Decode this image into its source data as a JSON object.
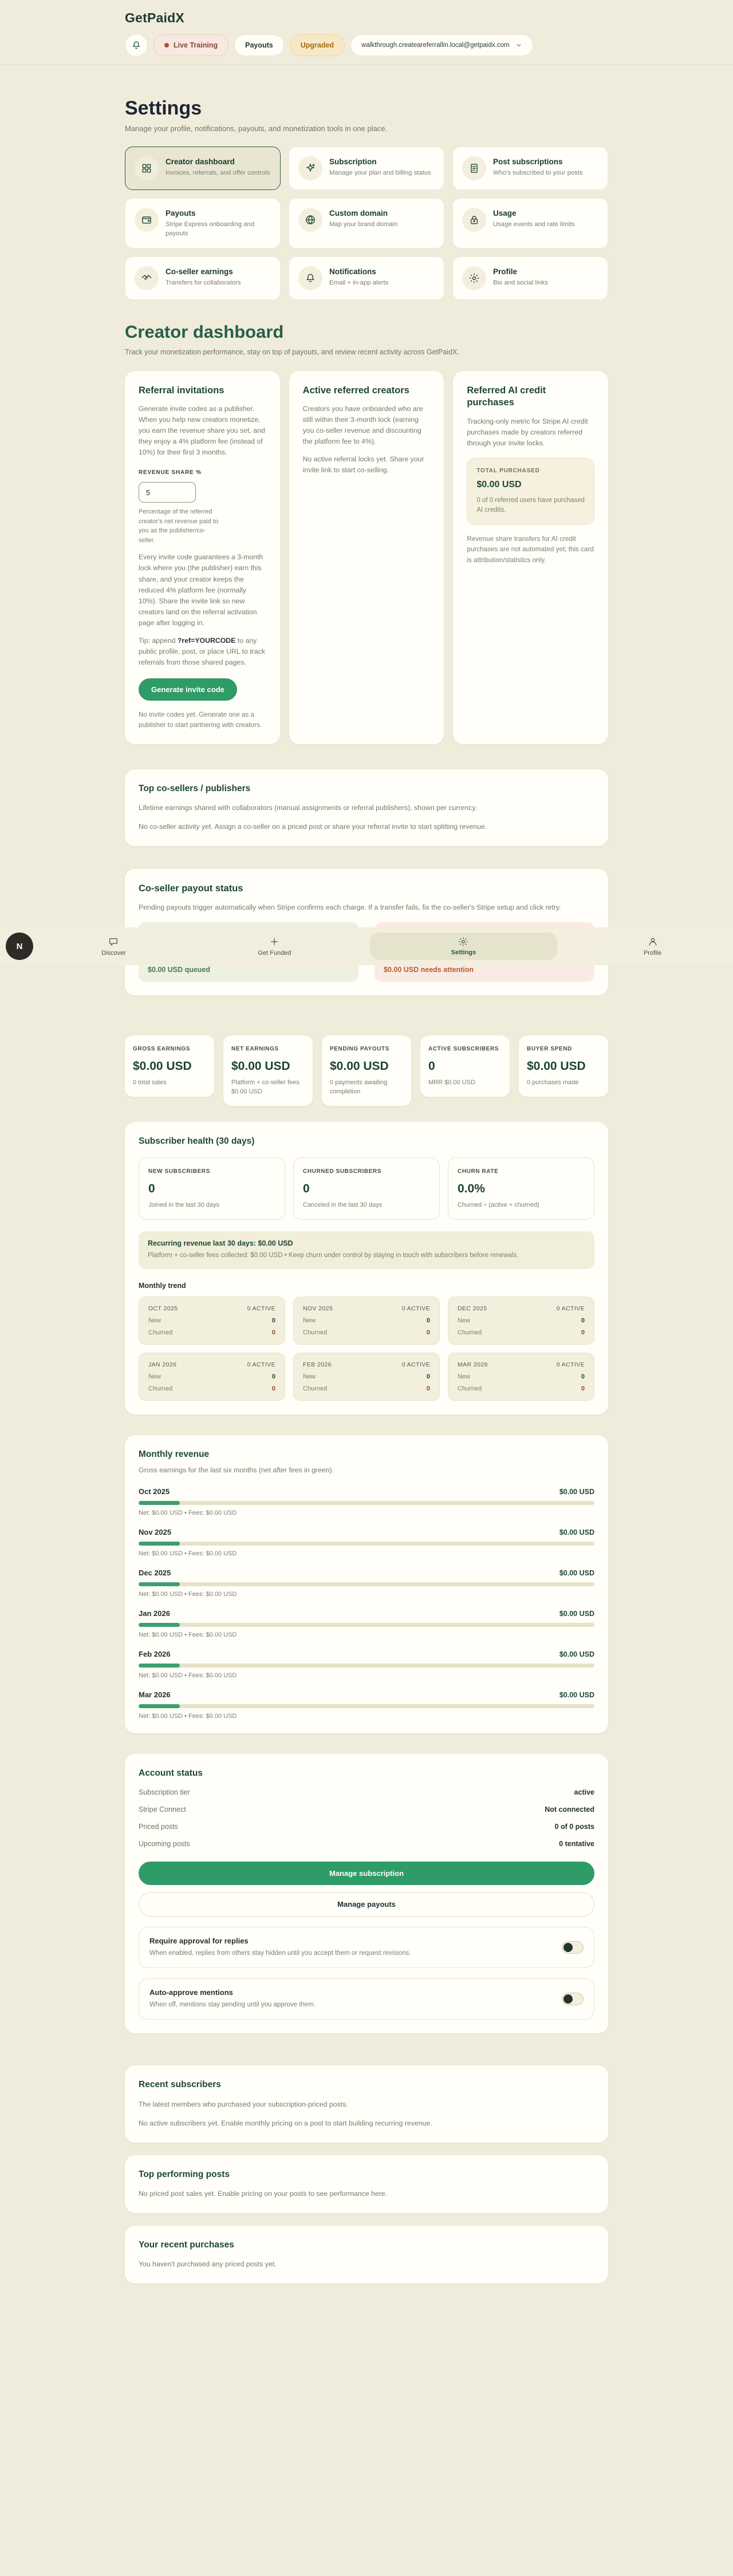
{
  "header": {
    "logo": "GetPaidX",
    "live_training": "Live Training",
    "payouts": "Payouts",
    "upgraded": "Upgraded",
    "email": "walkthrough.createareferrallin.local@getpaidx.com"
  },
  "settings": {
    "title": "Settings",
    "subtitle": "Manage your profile, notifications, payouts, and monetization tools in one place.",
    "cards": [
      {
        "title": "Creator dashboard",
        "desc": "Invoices, referrals, and offer controls"
      },
      {
        "title": "Subscription",
        "desc": "Manage your plan and billing status"
      },
      {
        "title": "Post subscriptions",
        "desc": "Who's subscribed to your posts"
      },
      {
        "title": "Payouts",
        "desc": "Stripe Express onboarding and payouts"
      },
      {
        "title": "Custom domain",
        "desc": "Map your brand domain"
      },
      {
        "title": "Usage",
        "desc": "Usage events and rate limits"
      },
      {
        "title": "Co-seller earnings",
        "desc": "Transfers for collaborators"
      },
      {
        "title": "Notifications",
        "desc": "Email + in-app alerts"
      },
      {
        "title": "Profile",
        "desc": "Bio and social links"
      }
    ]
  },
  "dashboard": {
    "title": "Creator dashboard",
    "subtitle": "Track your monetization performance, stay on top of payouts, and review recent activity across GetPaidX.",
    "referral": {
      "title": "Referral invitations",
      "intro": "Generate invite codes as a publisher. When you help new creators monetize, you earn the revenue share you set, and they enjoy a 4% platform fee (instead of 10%) for their first 3 months.",
      "share_label": "REVENUE SHARE %",
      "share_value": "5",
      "share_help": "Percentage of the referred creator's net revenue paid to you as the publisher/co-seller.",
      "lock_note": "Every invite code guarantees a 3-month lock where you (the publisher) earn this share, and your creator keeps the reduced 4% platform fee (normally 10%). Share the invite link so new creators land on the referral activation page after logging in.",
      "tip_prefix": "Tip: append ",
      "tip_code": "?ref=YOURCODE",
      "tip_suffix": " to any public profile, post, or place URL to track referrals from those shared pages.",
      "button": "Generate invite code",
      "empty": "No invite codes yet. Generate one as a publisher to start partnering with creators."
    },
    "active_referred": {
      "title": "Active referred creators",
      "desc": "Creators you have onboarded who are still within their 3-month lock (earning you co-seller revenue and discounting the platform fee to 4%).",
      "empty": "No active referral locks yet. Share your invite link to start co-selling."
    },
    "ai_credit": {
      "title": "Referred AI credit purchases",
      "desc": "Tracking-only metric for Stripe AI credit purchases made by creators referred through your invite locks.",
      "total_label": "TOTAL PURCHASED",
      "total_value": "$0.00 USD",
      "total_sub": "0 of 0 referred users have purchased AI credits.",
      "note": "Revenue share transfers for AI credit purchases are not automated yet; this card is attribution/statistics only."
    },
    "top_cosellers": {
      "title": "Top co-sellers / publishers",
      "desc": "Lifetime earnings shared with collaborators (manual assignments or referral publishers), shown per currency.",
      "empty": "No co-seller activity yet. Assign a co-seller on a priced post or share your referral invite to start splitting revenue."
    },
    "payout_status": {
      "title": "Co-seller payout status",
      "desc": "Pending payouts trigger automatically when Stripe confirms each charge. If a transfer fails, fix the co-seller's Stripe setup and click retry.",
      "queued": "$0.00 USD queued",
      "attention": "$0.00 USD needs attention"
    },
    "stats": [
      {
        "label": "GROSS EARNINGS",
        "value": "$0.00 USD",
        "sub": "0 total sales"
      },
      {
        "label": "NET EARNINGS",
        "value": "$0.00 USD",
        "sub": "Platform + co-seller fees $0.00 USD"
      },
      {
        "label": "PENDING PAYOUTS",
        "value": "$0.00 USD",
        "sub": "0 payments awaiting completion"
      },
      {
        "label": "ACTIVE SUBSCRIBERS",
        "value": "0",
        "sub": "MRR $0.00 USD"
      },
      {
        "label": "BUYER SPEND",
        "value": "$0.00 USD",
        "sub": "0 purchases made"
      }
    ],
    "subscriber_health": {
      "title": "Subscriber health (30 days)",
      "boxes": [
        {
          "label": "NEW SUBSCRIBERS",
          "value": "0",
          "sub": "Joined in the last 30 days"
        },
        {
          "label": "CHURNED SUBSCRIBERS",
          "value": "0",
          "sub": "Canceled in the last 30 days"
        },
        {
          "label": "CHURN RATE",
          "value": "0.0%",
          "sub": "Churned ÷ (active + churned)"
        }
      ],
      "recurring_title": "Recurring revenue last 30 days: $0.00 USD",
      "recurring_sub": "Platform + co-seller fees collected: $0.00 USD • Keep churn under control by staying in touch with subscribers before renewals.",
      "trend_title": "Monthly trend",
      "row_labels": {
        "new": "New",
        "churned": "Churned"
      },
      "months": [
        {
          "month": "OCT 2025",
          "active": "0 ACTIVE",
          "new": "0",
          "churned": "0"
        },
        {
          "month": "NOV 2025",
          "active": "0 ACTIVE",
          "new": "0",
          "churned": "0"
        },
        {
          "month": "DEC 2025",
          "active": "0 ACTIVE",
          "new": "0",
          "churned": "0"
        },
        {
          "month": "JAN 2026",
          "active": "0 ACTIVE",
          "new": "0",
          "churned": "0"
        },
        {
          "month": "FEB 2026",
          "active": "0 ACTIVE",
          "new": "0",
          "churned": "0"
        },
        {
          "month": "MAR 2026",
          "active": "0 ACTIVE",
          "new": "0",
          "churned": "0"
        }
      ]
    },
    "monthly_revenue": {
      "title": "Monthly revenue",
      "subtitle": "Gross earnings for the last six months (net after fees in green).",
      "rows": [
        {
          "month": "Oct 2025",
          "gross": "$0.00 USD",
          "net": "Net: $0.00 USD • Fees: $0.00 USD"
        },
        {
          "month": "Nov 2025",
          "gross": "$0.00 USD",
          "net": "Net: $0.00 USD • Fees: $0.00 USD"
        },
        {
          "month": "Dec 2025",
          "gross": "$0.00 USD",
          "net": "Net: $0.00 USD • Fees: $0.00 USD"
        },
        {
          "month": "Jan 2026",
          "gross": "$0.00 USD",
          "net": "Net: $0.00 USD • Fees: $0.00 USD"
        },
        {
          "month": "Feb 2026",
          "gross": "$0.00 USD",
          "net": "Net: $0.00 USD • Fees: $0.00 USD"
        },
        {
          "month": "Mar 2026",
          "gross": "$0.00 USD",
          "net": "Net: $0.00 USD • Fees: $0.00 USD"
        }
      ]
    },
    "account_status": {
      "title": "Account status",
      "rows": [
        {
          "label": "Subscription tier",
          "value": "active"
        },
        {
          "label": "Stripe Connect",
          "value": "Not connected"
        },
        {
          "label": "Priced posts",
          "value": "0 of 0 posts"
        },
        {
          "label": "Upcoming posts",
          "value": "0 tentative"
        }
      ],
      "manage_subscription": "Manage subscription",
      "manage_payouts": "Manage payouts",
      "toggles": [
        {
          "title": "Require approval for replies",
          "desc": "When enabled, replies from others stay hidden until you accept them or request revisions."
        },
        {
          "title": "Auto-approve mentions",
          "desc": "When off, mentions stay pending until you approve them."
        }
      ]
    },
    "recent_subscribers": {
      "title": "Recent subscribers",
      "desc": "The latest members who purchased your subscription-priced posts.",
      "empty": "No active subscribers yet. Enable monthly pricing on a post to start building recurring revenue."
    },
    "top_posts": {
      "title": "Top performing posts",
      "empty": "No priced post sales yet. Enable pricing on your posts to see performance here."
    },
    "recent_purchases": {
      "title": "Your recent purchases",
      "empty": "You haven't purchased any priced posts yet."
    }
  },
  "navbar": {
    "avatar": "N",
    "items": [
      {
        "label": "Discover"
      },
      {
        "label": "Get Funded"
      },
      {
        "label": "Settings"
      },
      {
        "label": "Profile"
      }
    ]
  }
}
